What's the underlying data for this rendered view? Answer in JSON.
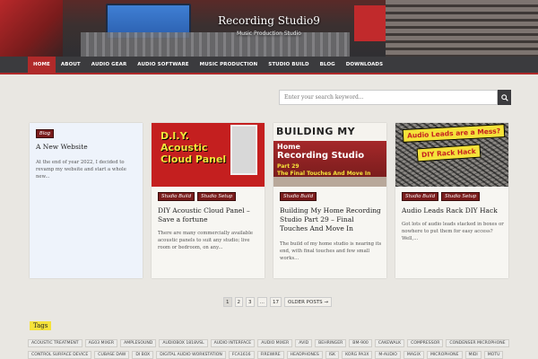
{
  "site": {
    "title": "Recording Studio9",
    "tagline": "Music Production Studio"
  },
  "nav": {
    "items": [
      {
        "label": "HOME",
        "active": true
      },
      {
        "label": "ABOUT"
      },
      {
        "label": "AUDIO GEAR"
      },
      {
        "label": "AUDIO SOFTWARE"
      },
      {
        "label": "MUSIC PRODUCTION"
      },
      {
        "label": "STUDIO BUILD"
      },
      {
        "label": "BLOG"
      },
      {
        "label": "DOWNLOADS"
      }
    ]
  },
  "search": {
    "placeholder": "Enter your search keyword...",
    "icon": "search-icon"
  },
  "posts": [
    {
      "categories": [
        "Blog"
      ],
      "title": "A New Website",
      "excerpt": "At the end of year 2022, I decided to revamp my website and start a whole new..."
    },
    {
      "image_text": [
        "D.I.Y.",
        "Acoustic",
        "Cloud Panel"
      ],
      "categories": [
        "Studio Build",
        "Studio Setup"
      ],
      "title": "DIY Acoustic Cloud Panel – Save a fortune",
      "excerpt": "There are many commercially available acoustic panels to suit any studio; live room or bedroom, on any..."
    },
    {
      "image_text": [
        "BUILDING MY",
        "Home",
        "Recording Studio",
        "Part 29",
        "The Final Touches And Move In"
      ],
      "categories": [
        "Studio Build"
      ],
      "title": "Building My Home Recording Studio Part 29 – Final Touches And Move In",
      "excerpt": "The build of my home studio is nearing its end, with final touches and few small works..."
    },
    {
      "image_text": [
        "Audio Leads are a Mess?",
        "DIY Rack Hack"
      ],
      "categories": [
        "Studio Build",
        "Studio Setup"
      ],
      "title": "Audio Leads Rack DIY Hack",
      "excerpt": "Got lots of audio leads stacked in boxes or nowhere to put them for easy access? Well,..."
    }
  ],
  "pagination": {
    "pages": [
      "1",
      "2",
      "3",
      "…",
      "17"
    ],
    "current": "1",
    "next_label": "OLDER POSTS →"
  },
  "tags": {
    "heading": "Tags",
    "row1": [
      "ACOUSTIC TREATMENT",
      "AG03 MIXER",
      "AMPLESOUND",
      "AUDIOBOX 1818VSL",
      "AUDIO INTERFACE",
      "AUDIO MIXER",
      "AVID",
      "BEHRINGER",
      "BM-900",
      "CAKEWALK",
      "COMPRESSOR",
      "CONDENSER MICROPHONE"
    ],
    "row2": [
      "CONTROL SURFACE DEVICE",
      "CUBASE DAW",
      "DI BOX",
      "DIGITAL AUDIO WORKSTATION",
      "FCA1616",
      "FIREWIRE",
      "HEADPHONES",
      "ISK",
      "KORG PA3X",
      "M-AUDIO",
      "MAGIX",
      "MICROPHONE",
      "MIDI",
      "MOTU"
    ]
  },
  "colors": {
    "accent": "#b02a2a",
    "badge": "#7a1c1c",
    "nav_bg": "#3b3b3e",
    "tag_heading": "#f5e23a"
  }
}
